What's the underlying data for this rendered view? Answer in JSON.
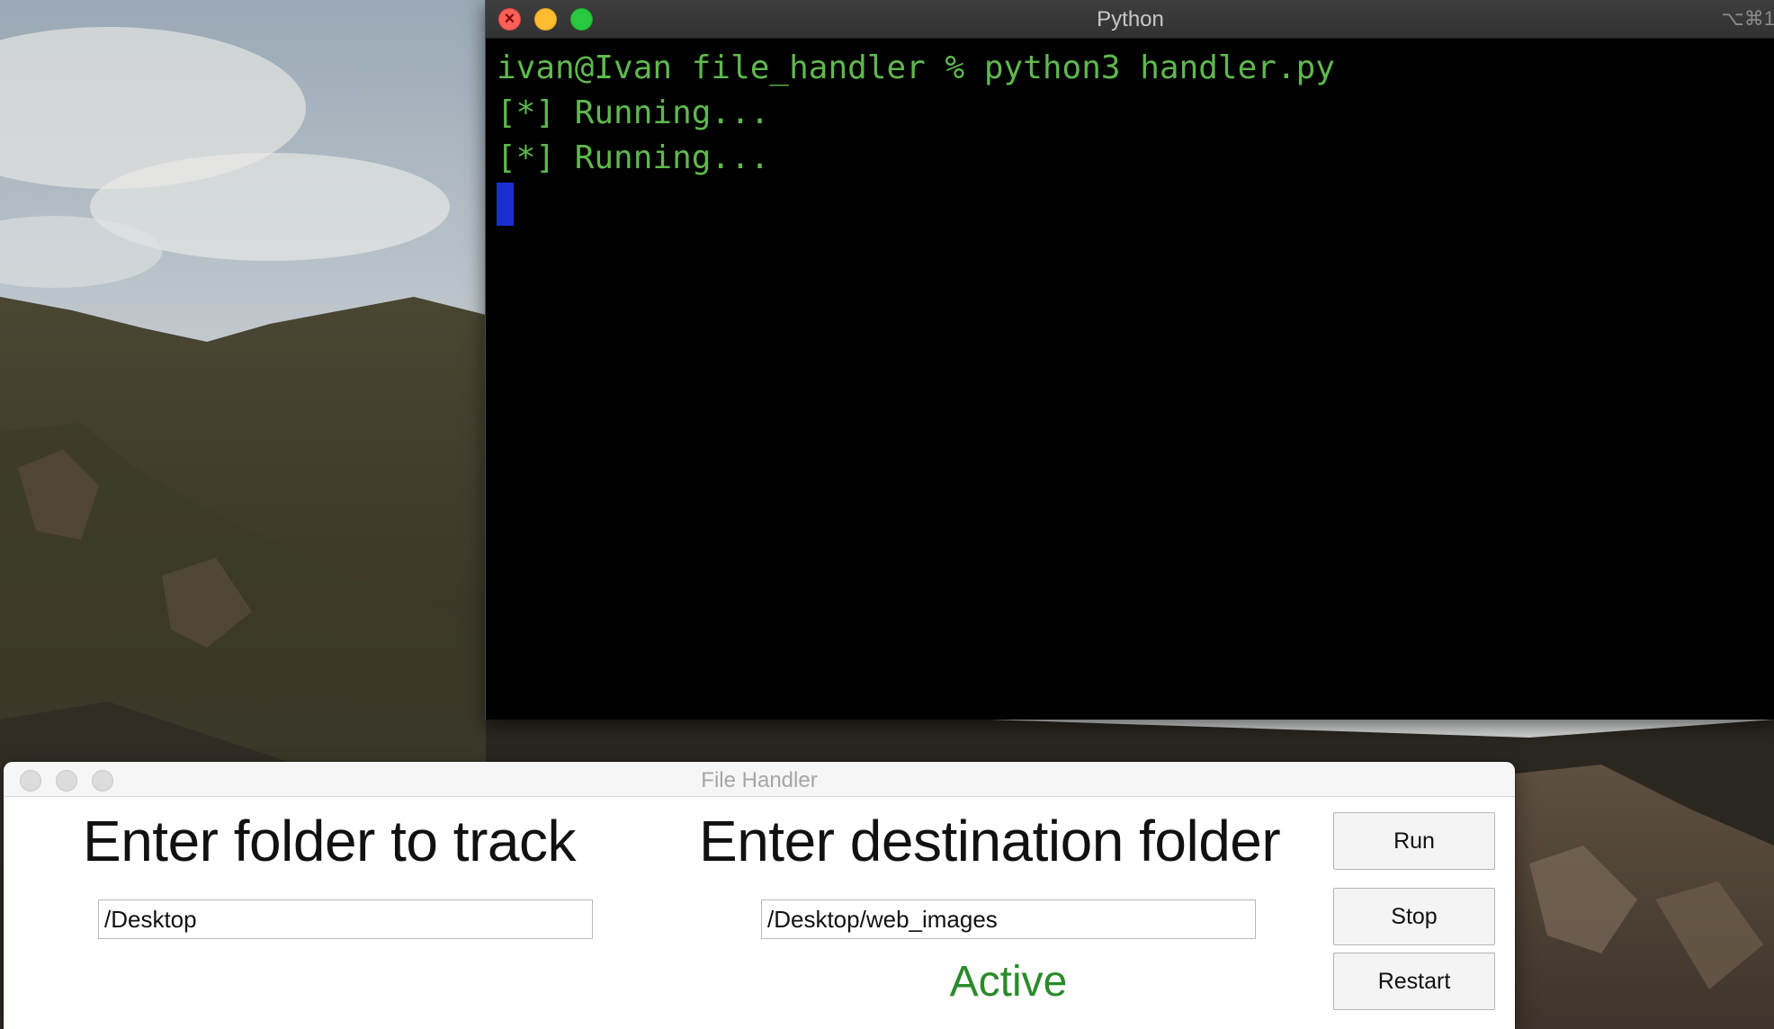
{
  "terminal": {
    "title": "Python",
    "shortcut": "⌥⌘1",
    "lines": [
      "ivan@Ivan file_handler % python3 handler.py",
      "[*] Running...",
      "[*] Running..."
    ]
  },
  "file_handler": {
    "title": "File Handler",
    "track_heading": "Enter folder to track",
    "dest_heading": "Enter destination folder",
    "track_value": "/Desktop",
    "dest_value": "/Desktop/web_images",
    "status": "Active",
    "status_color": "#2a8b2a",
    "buttons": {
      "run": "Run",
      "stop": "Stop",
      "restart": "Restart"
    }
  },
  "colors": {
    "terminal_text": "#5fb84e",
    "cursor": "#1a2fd0",
    "close": "#fe5f57",
    "minimize": "#febc2e",
    "maximize": "#28c840"
  }
}
